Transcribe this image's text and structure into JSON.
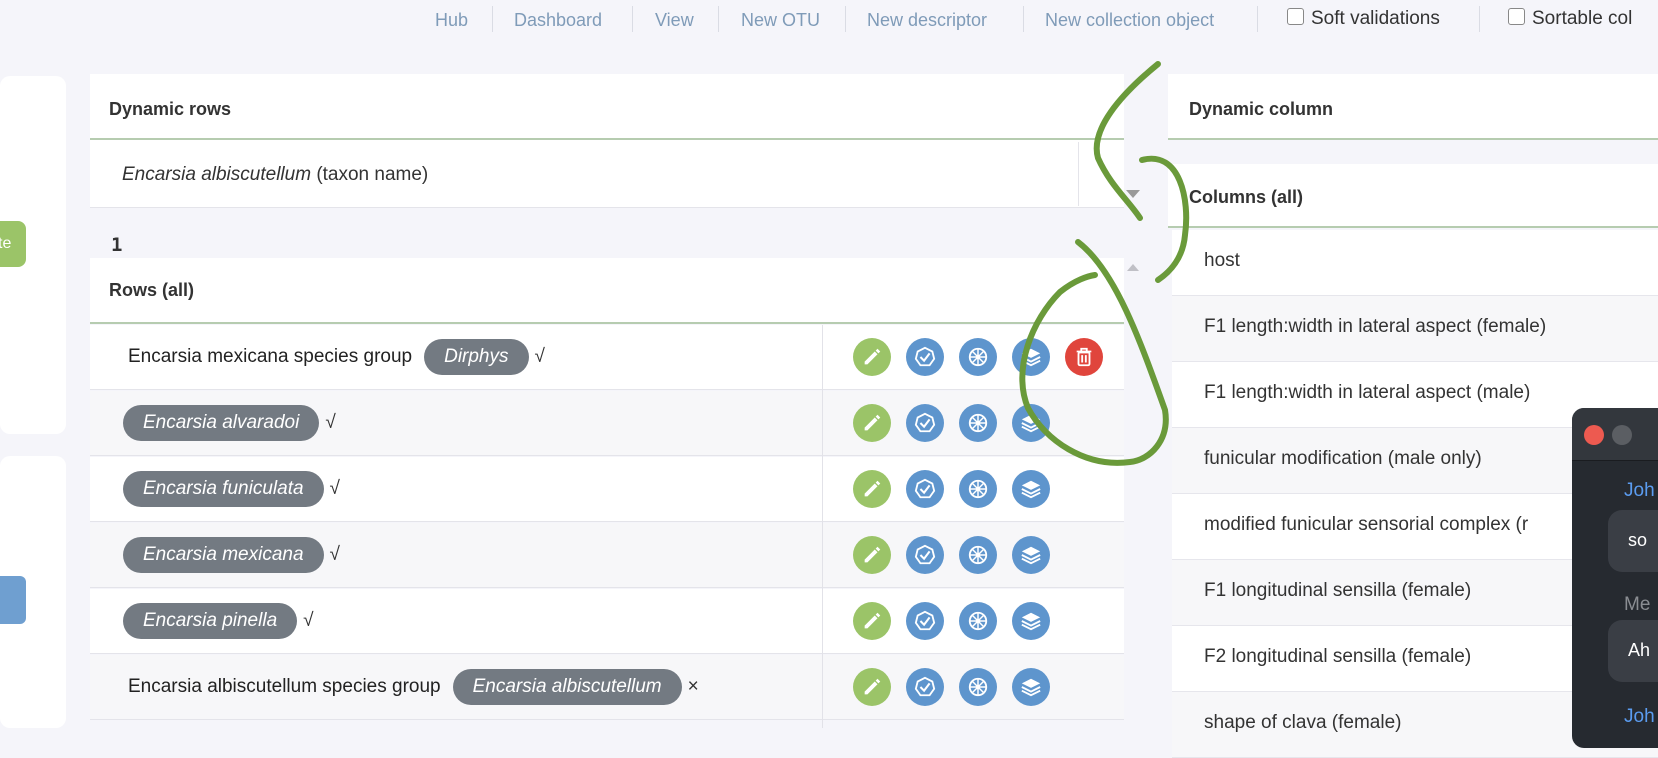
{
  "nav": {
    "links": [
      "Hub",
      "Dashboard",
      "View",
      "New OTU",
      "New descriptor",
      "New collection object"
    ],
    "soft_validations": "Soft validations",
    "sortable_columns": "Sortable col"
  },
  "left": {
    "green_button_label": "te"
  },
  "dynamic_rows": {
    "title": "Dynamic rows",
    "selected_name": "Encarsia albiscutellum",
    "selected_suffix": "(taxon name)",
    "count": "1",
    "rows_title": "Rows (all)",
    "rows": [
      {
        "prefix": "Encarsia mexicana species group",
        "pill": "Dirphys",
        "mark": "√"
      },
      {
        "prefix": "",
        "pill": "Encarsia alvaradoi",
        "mark": "√"
      },
      {
        "prefix": "",
        "pill": "Encarsia funiculata",
        "mark": "√"
      },
      {
        "prefix": "",
        "pill": "Encarsia mexicana",
        "mark": "√"
      },
      {
        "prefix": "",
        "pill": "Encarsia pinella",
        "mark": "√"
      },
      {
        "prefix": "Encarsia albiscutellum species group",
        "pill": "Encarsia albiscutellum",
        "mark": "×"
      }
    ]
  },
  "dynamic_column": {
    "title": "Dynamic column",
    "columns_title": "Columns (all)",
    "columns": [
      "host",
      "F1 length:width in lateral aspect (female)",
      "F1 length:width in lateral aspect (male)",
      "funicular modification (male only)",
      "modified funicular sensorial complex (r",
      "F1 longitudinal sensilla (female)",
      "F2 longitudinal sensilla (female)",
      "shape of clava (female)"
    ]
  },
  "chat": {
    "sender1": "Joh",
    "msg1": "so",
    "sender2": "Me",
    "msg2": "Ah",
    "sender3": "Joh"
  },
  "colors": {
    "edit": "#9bc468",
    "action": "#5e95cd",
    "delete": "#e0453c",
    "pill": "#737a82",
    "annotation": "#6a9a3a"
  },
  "icons": [
    "pencil-icon",
    "check-badge-icon",
    "wheel-icon",
    "layers-icon",
    "trash-icon",
    "close-dot-icon"
  ]
}
